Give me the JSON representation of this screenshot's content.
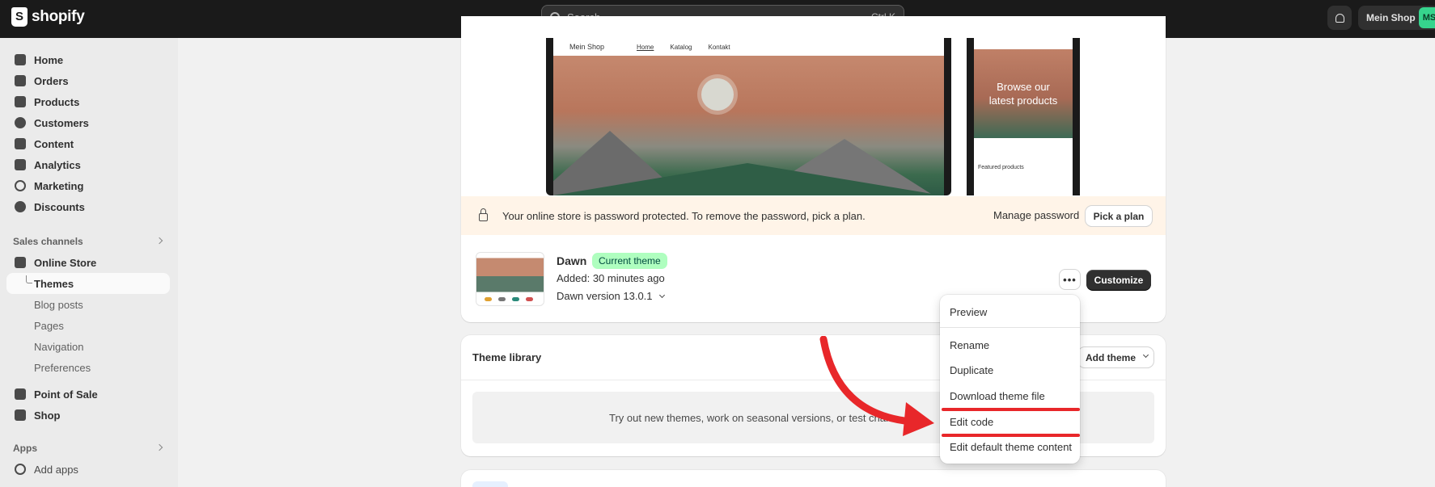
{
  "topbar": {
    "brand": "shopify",
    "search_placeholder": "Search",
    "search_shortcut": "Ctrl K",
    "shop_name": "Mein Shop",
    "avatar_initials": "MS"
  },
  "sidebar": {
    "main_items": [
      {
        "label": "Home",
        "icon": "home-icon"
      },
      {
        "label": "Orders",
        "icon": "inbox-icon"
      },
      {
        "label": "Products",
        "icon": "tag-icon"
      },
      {
        "label": "Customers",
        "icon": "person-icon"
      },
      {
        "label": "Content",
        "icon": "content-icon"
      },
      {
        "label": "Analytics",
        "icon": "bar-chart-icon"
      },
      {
        "label": "Marketing",
        "icon": "target-icon"
      },
      {
        "label": "Discounts",
        "icon": "discount-icon"
      }
    ],
    "sales_channels_label": "Sales channels",
    "online_store": "Online Store",
    "online_store_sub": [
      "Themes",
      "Blog posts",
      "Pages",
      "Navigation",
      "Preferences"
    ],
    "point_of_sale": "Point of Sale",
    "shop": "Shop",
    "apps_label": "Apps",
    "add_apps": "Add apps"
  },
  "preview": {
    "desktop_brand": "Mein Shop",
    "desktop_nav": [
      "Home",
      "Katalog",
      "Kontakt"
    ],
    "mobile_hero_line1": "Browse our",
    "mobile_hero_line2": "latest products",
    "mobile_featured": "Featured products"
  },
  "banner": {
    "message": "Your online store is password protected. To remove the password, pick a plan.",
    "manage_label": "Manage password",
    "pick_plan_label": "Pick a plan"
  },
  "current_theme": {
    "name": "Dawn",
    "badge": "Current theme",
    "added": "Added: 30 minutes ago",
    "version": "Dawn version 13.0.1",
    "customize_label": "Customize",
    "more_label": "•••"
  },
  "theme_menu": {
    "items": [
      "Preview",
      "Rename",
      "Duplicate",
      "Download theme file",
      "Edit code",
      "Edit default theme content"
    ]
  },
  "theme_library": {
    "title": "Theme library",
    "add_theme_label": "Add theme",
    "empty_text": "Try out new themes, work on seasonal versions, or test chan"
  },
  "colors": {
    "annotation_red": "#e8272a",
    "badge_green": "#affebf",
    "topbar": "#1a1a1a"
  }
}
